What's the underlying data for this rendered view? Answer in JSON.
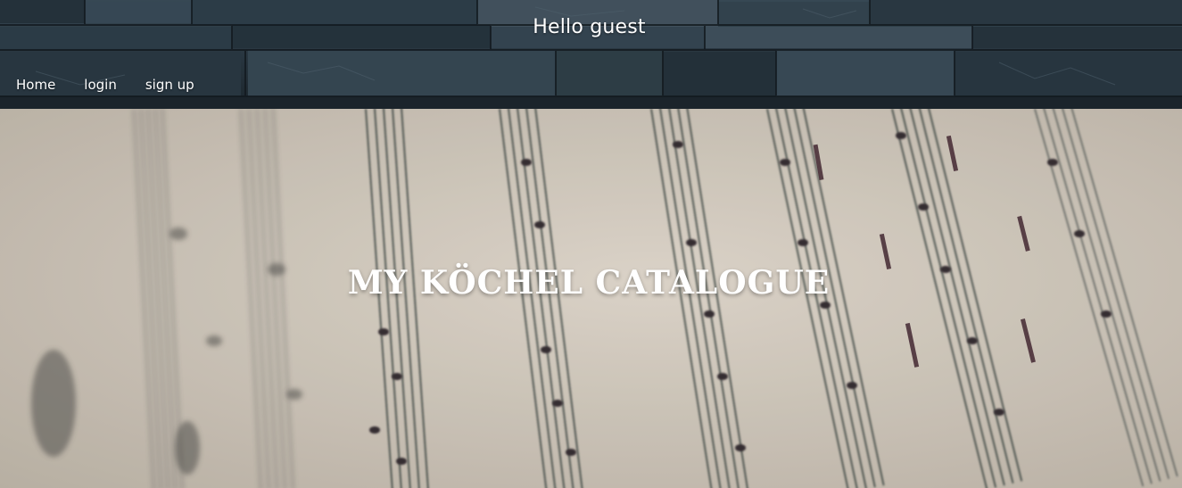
{
  "header": {
    "greeting": "Hello guest"
  },
  "nav": {
    "items": [
      {
        "label": "Home"
      },
      {
        "label": "login"
      },
      {
        "label": "sign up"
      }
    ]
  },
  "hero": {
    "title": "MY KÖCHEL CATALOGUE"
  },
  "colors": {
    "header_background": "#2b3a45",
    "hero_background": "#cbc2b6",
    "text": "#ffffff"
  }
}
